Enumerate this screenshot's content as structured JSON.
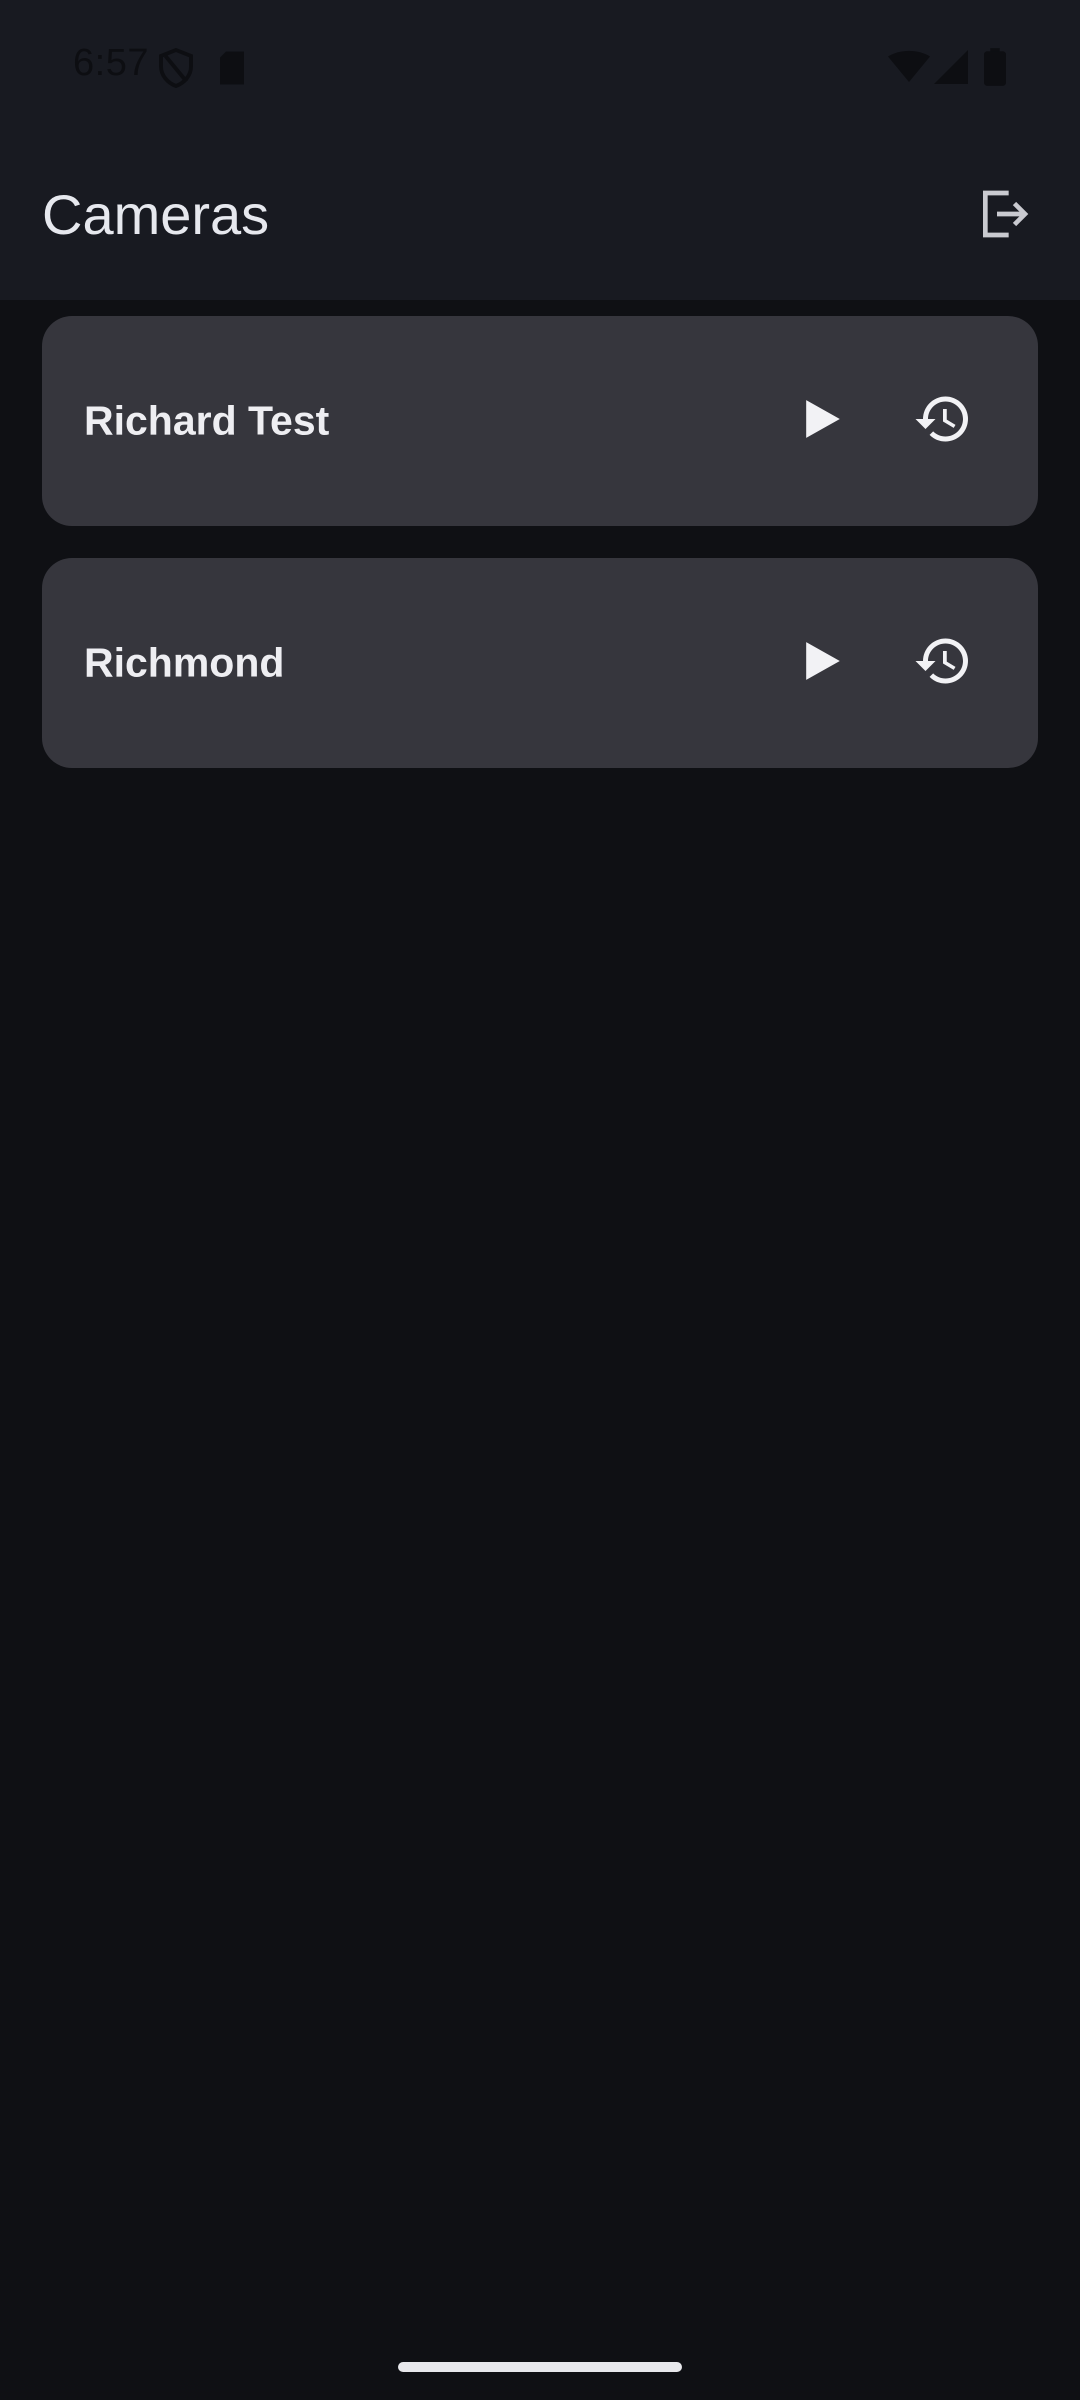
{
  "status_bar": {
    "time": "6:57",
    "icons": [
      "shield-icon",
      "sdcard-icon",
      "wifi-icon",
      "signal-icon",
      "battery-icon"
    ]
  },
  "app_bar": {
    "title": "Cameras",
    "logout_icon": "logout-icon"
  },
  "cameras": [
    {
      "name": "Richard Test",
      "play_icon": "play-icon",
      "history_icon": "history-icon"
    },
    {
      "name": "Richmond",
      "play_icon": "play-icon",
      "history_icon": "history-icon"
    }
  ],
  "colors": {
    "background": "#0f1014",
    "app_bar": "#181a21",
    "card": "#36363d",
    "text": "#eeeef2"
  }
}
